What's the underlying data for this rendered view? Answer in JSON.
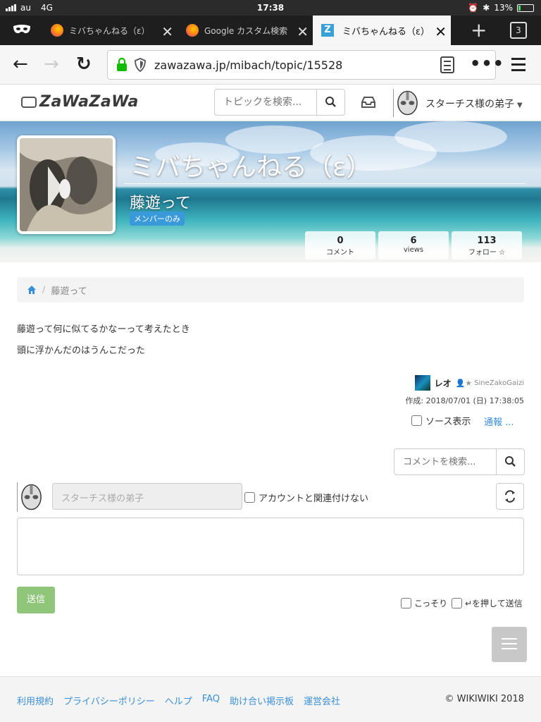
{
  "status_bar": {
    "carrier": "au",
    "network": "4G",
    "time": "17:38",
    "battery": "13%",
    "battery_level": 0.13
  },
  "tabs": [
    {
      "title": "ミバちゃんねる（ε）"
    },
    {
      "title": "Google カスタム検索"
    },
    {
      "title": "ミバちゃんねる（ε）"
    }
  ],
  "tab_count": "3",
  "toolbar": {
    "url": "zawazawa.jp/mibach/topic/15528"
  },
  "site": {
    "logo": "ZaWaZaWa",
    "search_placeholder": "トピックを検索...",
    "username": "スターチス様の弟子"
  },
  "banner": {
    "title": "ミバちゃんねる（ε）",
    "topic": "藤遊って",
    "badge": "メンバーのみ",
    "stats": [
      {
        "value": "0",
        "label": "コメント"
      },
      {
        "value": "6",
        "label": "views"
      },
      {
        "value": "113",
        "label": "フォロー ☆"
      }
    ]
  },
  "breadcrumb": {
    "current": "藤遊って"
  },
  "post": {
    "lines": [
      "藤遊って何に似てるかなーって考えたとき",
      "頭に浮かんだのはうんこだった"
    ],
    "author": "レオ",
    "author_id": "SineZakoGaizi",
    "created": "作成: 2018/07/01 (日) 17:38:05",
    "source_label": "ソース表示",
    "report_label": "通報 ..."
  },
  "comments": {
    "search_placeholder": "コメントを検索...",
    "name_placeholder": "スターチス様の弟子",
    "no_link_label": "アカウントと関連付けない",
    "send_label": "送信",
    "stealth_label": "こっそり",
    "enter_send_label": "↵を押して送信"
  },
  "footer": {
    "links": [
      "利用規約",
      "プライバシーポリシー",
      "ヘルプ",
      "FAQ",
      "助け合い掲示板",
      "運営会社"
    ],
    "copyright": "© WIKIWIKI 2018"
  },
  "colors": {
    "accent": "#3a8fd9",
    "badge": "#3a9ad9",
    "send": "#8fc67a",
    "tab_bar": "#1e1e1e"
  }
}
